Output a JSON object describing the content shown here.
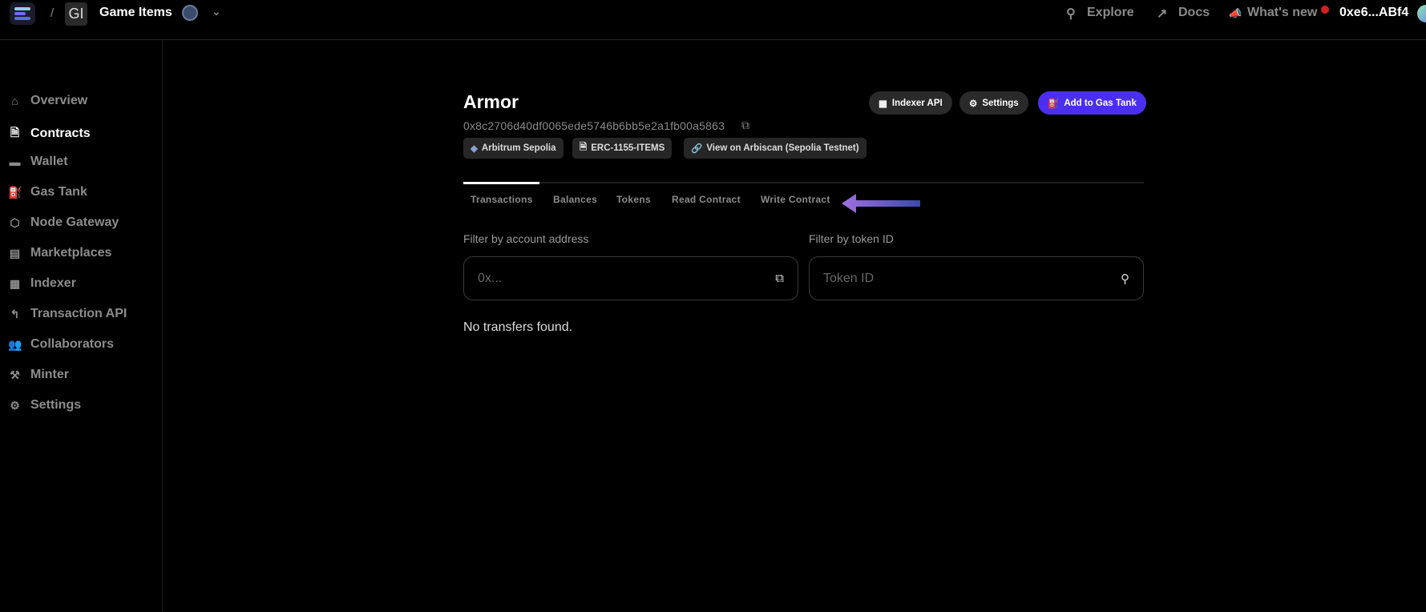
{
  "topbar": {
    "project_initials": "GI",
    "project_name": "Game Items",
    "separator": "/",
    "explore": "Explore",
    "docs": "Docs",
    "whats_new": "What's new",
    "wallet_address": "0xe6...ABf4"
  },
  "sidebar": {
    "items": [
      {
        "label": "Overview",
        "icon": "home-icon"
      },
      {
        "label": "Contracts",
        "icon": "contract-icon",
        "active": true
      },
      {
        "label": "Wallet",
        "icon": "wallet-icon"
      },
      {
        "label": "Gas Tank",
        "icon": "gas-pump-icon"
      },
      {
        "label": "Node Gateway",
        "icon": "cube-icon"
      },
      {
        "label": "Marketplaces",
        "icon": "store-icon"
      },
      {
        "label": "Indexer",
        "icon": "grid-icon"
      },
      {
        "label": "Transaction API",
        "icon": "route-icon"
      },
      {
        "label": "Collaborators",
        "icon": "users-icon"
      },
      {
        "label": "Minter",
        "icon": "anvil-icon"
      },
      {
        "label": "Settings",
        "icon": "gear-icon"
      }
    ]
  },
  "contract": {
    "name": "Armor",
    "address": "0x8c2706d40df0065ede5746b6bb5e2a1fb00a5863",
    "badges": {
      "network": "Arbitrum Sepolia",
      "type": "ERC-1155-ITEMS",
      "explorer": "View on Arbiscan (Sepolia Testnet)"
    },
    "buttons": {
      "indexer": "Indexer API",
      "settings": "Settings",
      "gas_tank": "Add to Gas Tank"
    }
  },
  "tabs": [
    "Transactions",
    "Balances",
    "Tokens",
    "Read Contract",
    "Write Contract"
  ],
  "active_tab": "Transactions",
  "filters": {
    "account_label": "Filter by account address",
    "account_placeholder": "0x...",
    "token_label": "Filter by token ID",
    "token_placeholder": "Token ID"
  },
  "empty_message": "No transfers found.",
  "colors": {
    "accent": "#4b2ff0",
    "annotation_arrow": "#9a6ae0"
  }
}
